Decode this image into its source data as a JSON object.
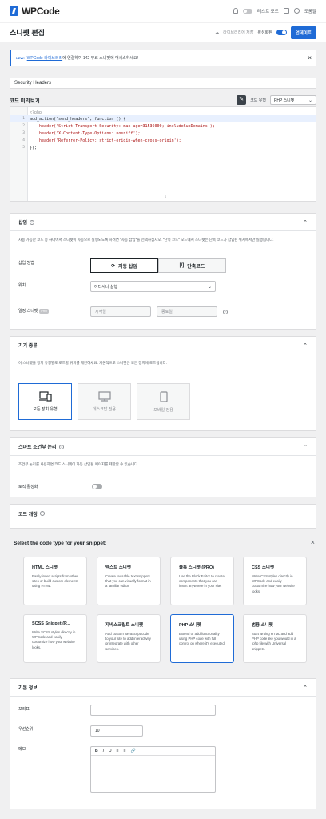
{
  "app": {
    "name": "WPCode",
    "test_mode_label": "테스트 모드",
    "help_label": "도움말"
  },
  "titlebar": {
    "title": "스니펫 편집",
    "library_label": "라이브러리에 저장",
    "active_label": "활성화된",
    "update_label": "업데이트"
  },
  "notice": {
    "badge": "NEW!",
    "link": "WPCode 라이브러리",
    "text": "에 연결하여 142 무료 스니펫에 액세스하세요!"
  },
  "snippet": {
    "title": "Security Headers"
  },
  "code_preview": {
    "title": "코드 미리보기",
    "type_label": "코드 유형",
    "type_value": "PHP 스니펫",
    "lines": [
      {
        "num": "",
        "text": "<?php",
        "style": "comment"
      },
      {
        "num": "1",
        "text": "add_action('send_headers', function () {",
        "style": ""
      },
      {
        "num": "2",
        "text": "    header('Strict-Transport-Security: max-age=31536000; includeSubDomains');",
        "style": "str"
      },
      {
        "num": "3",
        "text": "    header('X-Content-Type-Options: nosniff');",
        "style": "str"
      },
      {
        "num": "4",
        "text": "    header('Referrer-Policy: strict-origin-when-cross-origin');",
        "style": "str"
      },
      {
        "num": "5",
        "text": "});",
        "style": ""
      }
    ]
  },
  "insertion": {
    "title": "삽입",
    "desc": "사용 가능한 코드 중 하나에서 스니펫이 자동으로 실행되도록 하려면 \"자동 삽입\"을 선택하십시오. \"단축 코드\" 모드에서 스니펫은 단축 코드가 삽입된 위치에서만 실행됩니다.",
    "method_label": "삽입 방법",
    "auto_insert": "자동 삽입",
    "shortcode": "단축코드",
    "location_label": "위치",
    "location_value": "어디서나 실행",
    "schedule_label": "일정 스니펫",
    "pro_badge": "PRO",
    "start_placeholder": "시작일",
    "end_placeholder": "종료일"
  },
  "device": {
    "title": "기기 종류",
    "desc": "이 스니펫을 장치 유형별로 로드할 위치를 제한하세요. 기본적으로 스니펫은 모든 장치에 로드됩니다.",
    "options": [
      "모든 장치 유형",
      "데스크탑 전용",
      "모바일 전용"
    ]
  },
  "smart_logic": {
    "title": "스마트 조건부 논리",
    "desc": "조건부 논리를 사용하면 코드 스니펫이 자동 삽입될 페이지를 제한할 수 있습니다.",
    "toggle_label": "로직 활성화"
  },
  "code_revisions": {
    "title": "코드 개정"
  },
  "code_type_modal": {
    "title": "Select the code type for your snippet:",
    "types": [
      {
        "title": "HTML 스니펫",
        "desc": "Easily insert scripts from other sites or build custom elements using HTML."
      },
      {
        "title": "텍스트 스니펫",
        "desc": "Create reusable text snippets that you can visually format in a familiar editor."
      },
      {
        "title": "블록 스니펫 (PRO)",
        "desc": "Use the Block Editor to create components that you can insert anywhere in your site."
      },
      {
        "title": "CSS 스니펫",
        "desc": "Write CSS styles directly in WPCode and easily customize how your website looks."
      },
      {
        "title": "SCSS Snippet (P...",
        "desc": "Write SCSS styles directly in WPCode and easily customize how your website looks."
      },
      {
        "title": "자바스크립트 스니펫",
        "desc": "Add custom JavaScript code to your site to add interactivity or integrate with other services."
      },
      {
        "title": "PHP 스니펫",
        "desc": "Extend or add functionality using PHP code with full control on where it's executed"
      },
      {
        "title": "범용 스니펫",
        "desc": "Start writing HTML and add PHP code like you would in a .php file with Universal snippets."
      }
    ]
  },
  "basic_info": {
    "title": "기본 정보",
    "tags_label": "꼬리표",
    "priority_label": "우선순위",
    "priority_value": "10",
    "notes_label": "메모",
    "toolbar": [
      "B",
      "I",
      "U",
      "≡",
      "≡",
      "🔗"
    ]
  }
}
